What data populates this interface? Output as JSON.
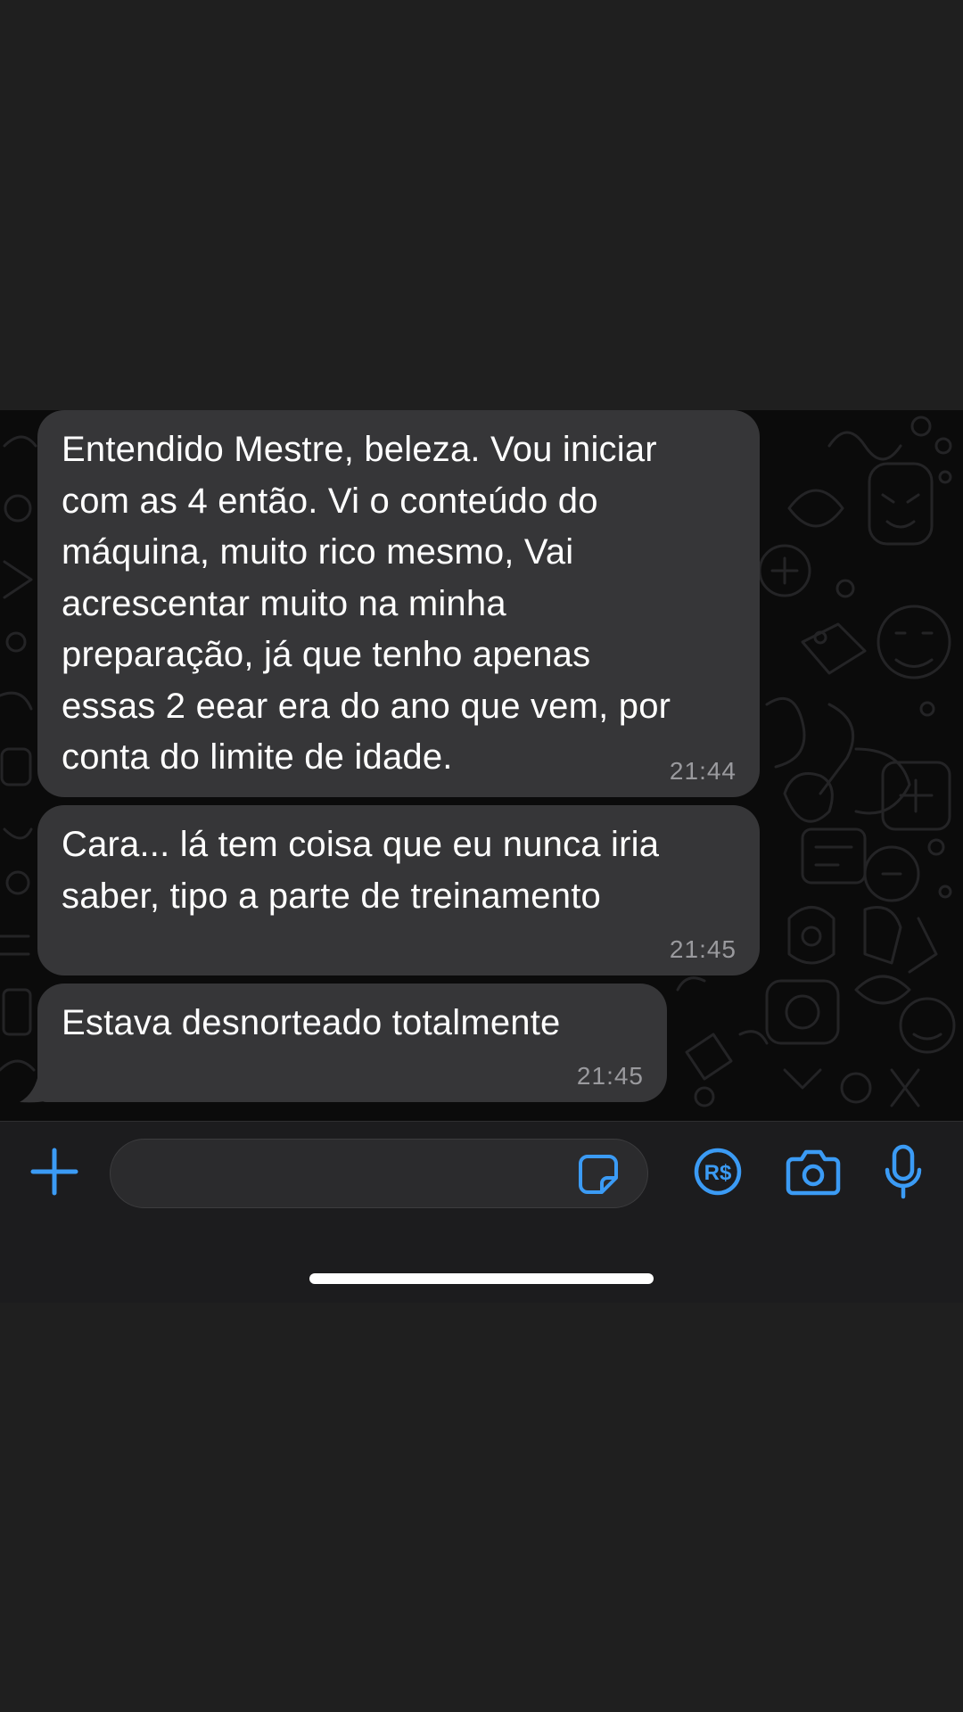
{
  "messages": [
    {
      "text": "Entendido Mestre, beleza. Vou iniciar\ncom as 4 então. Vi o conteúdo do\nmáquina,  muito rico mesmo,  Vai\nacrescentar muito na minha\npreparação, já que tenho apenas\nessas 2 eear era do ano que vem, por\nconta do limite de idade.",
      "time": "21:44"
    },
    {
      "text": "Cara... lá tem coisa que eu nunca iria\nsaber, tipo a parte de treinamento",
      "time": "21:45"
    },
    {
      "text": "Estava desnorteado totalmente",
      "time": "21:45"
    }
  ],
  "composer": {
    "message_value": "",
    "icons": [
      "plus-icon",
      "sticker-icon",
      "pix-payment-icon",
      "camera-icon",
      "microphone-icon"
    ],
    "accent_color": "#3b9bf5"
  },
  "colors": {
    "bubble_background": "#363638",
    "chat_background": "#0b0b0b",
    "screen_background": "#1f1f1f"
  }
}
